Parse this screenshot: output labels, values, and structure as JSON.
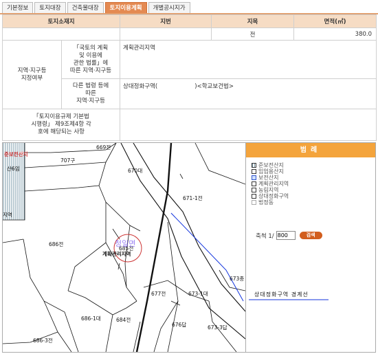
{
  "tabs": [
    {
      "label": "기본정보",
      "active": false
    },
    {
      "label": "토지대장",
      "active": false
    },
    {
      "label": "건축물대장",
      "active": false
    },
    {
      "label": "토지이용계획",
      "active": true
    },
    {
      "label": "개별공시지가",
      "active": false
    }
  ],
  "info": {
    "headers": {
      "location": "토지소재지",
      "lot_number": "지번",
      "land_category": "지목",
      "area": "면적(㎡)"
    },
    "row": {
      "location": "",
      "lot_number": "",
      "land_category": "전",
      "area": "380.0"
    },
    "zoning_label": "지역·지구등\n지정여부",
    "national_act_label": "「국토의 계획\n및 이용에\n관한 법률」에\n따른 지역·지구등",
    "national_act_value": "계획관리지역",
    "other_act_label": "다른 법령 등에\n따른\n지역·지구등",
    "other_act_value": "상대정화구역(                    )<학교보건법>",
    "regulation_label": "「토지이용규제 기본법\n시행령」 제9조제4항 각\n호에 해당되는 사항",
    "regulation_value": ""
  },
  "map": {
    "labels": {
      "semi_preserve": "준보전산지",
      "parcel_669": "669전",
      "parcel_707": "707구",
      "parcel_san6": "산6임",
      "parcel_670": "670대",
      "parcel_671": "671-1전",
      "parcel_686": "686전",
      "parcel_685": "685전",
      "stamp": "청일면",
      "planned": "계획관리지역",
      "parcel_673": "673종",
      "parcel_677": "677전",
      "parcel_673_1": "673-1대",
      "parcel_686_1": "686-1대",
      "parcel_684": "684전",
      "parcel_676": "676답",
      "parcel_673_3": "673-3답",
      "parcel_686_3": "686-3전",
      "edge_ji": "지역"
    }
  },
  "legend": {
    "title": "범례",
    "items": [
      {
        "label": "준보전산지",
        "pattern": "lines"
      },
      {
        "label": "임업용산지",
        "pattern": "none"
      },
      {
        "label": "보전산지",
        "pattern": "blue"
      },
      {
        "label": "계획관리지역",
        "pattern": "none"
      },
      {
        "label": "농림지역",
        "pattern": "none"
      },
      {
        "label": "상대정화구역",
        "pattern": "none"
      },
      {
        "label": "법정동",
        "pattern": "none"
      }
    ],
    "scale_label": "축척 1/",
    "scale_value": "800",
    "scale_button": "검색",
    "zone_boundary_label": "상대정화구역 경계선"
  }
}
